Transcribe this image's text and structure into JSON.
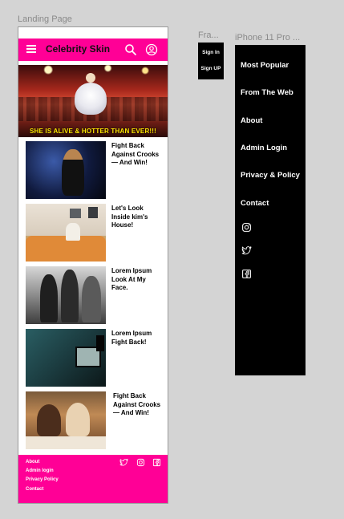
{
  "frames": {
    "landing_label": "Landing Page",
    "small_label": "Fra...",
    "menu_label": "iPhone 11 Pro ..."
  },
  "landing": {
    "brand": "Celebrity Skin",
    "hero_caption": "SHE IS ALIVE & HOTTER THAN EVER!!!",
    "articles": [
      {
        "title": "Fight Back Against Crooks — And Win!",
        "thumb": "concert-singer-photo"
      },
      {
        "title": "Let's Look Inside kim's House!",
        "thumb": "living-room-photo"
      },
      {
        "title": "Lorem Ipsum Look At My Face.",
        "thumb": "vintage-group-photo"
      },
      {
        "title": "Lorem Ipsum Fight Back!",
        "thumb": "video-call-photo"
      },
      {
        "title": "Fight Back Against Crooks — And Win!",
        "thumb": "friends-dinner-photo"
      }
    ],
    "footer_links": [
      "About",
      "Admin login",
      "Privacy Policy",
      "Contact"
    ],
    "icons": {
      "menu": "hamburger-icon",
      "search": "search-icon",
      "account": "user-icon",
      "twitter": "twitter-icon",
      "instagram": "instagram-icon",
      "facebook": "facebook-icon"
    },
    "colors": {
      "accent": "#ff0096",
      "caption": "#ffe600"
    }
  },
  "small_frame": {
    "sign_in": "Sign In",
    "sign_up": "Sign UP"
  },
  "menu": {
    "items": [
      "Most Popular",
      "From The Web",
      "About",
      "Admin Login",
      "Privacy & Policy",
      "Contact"
    ]
  }
}
